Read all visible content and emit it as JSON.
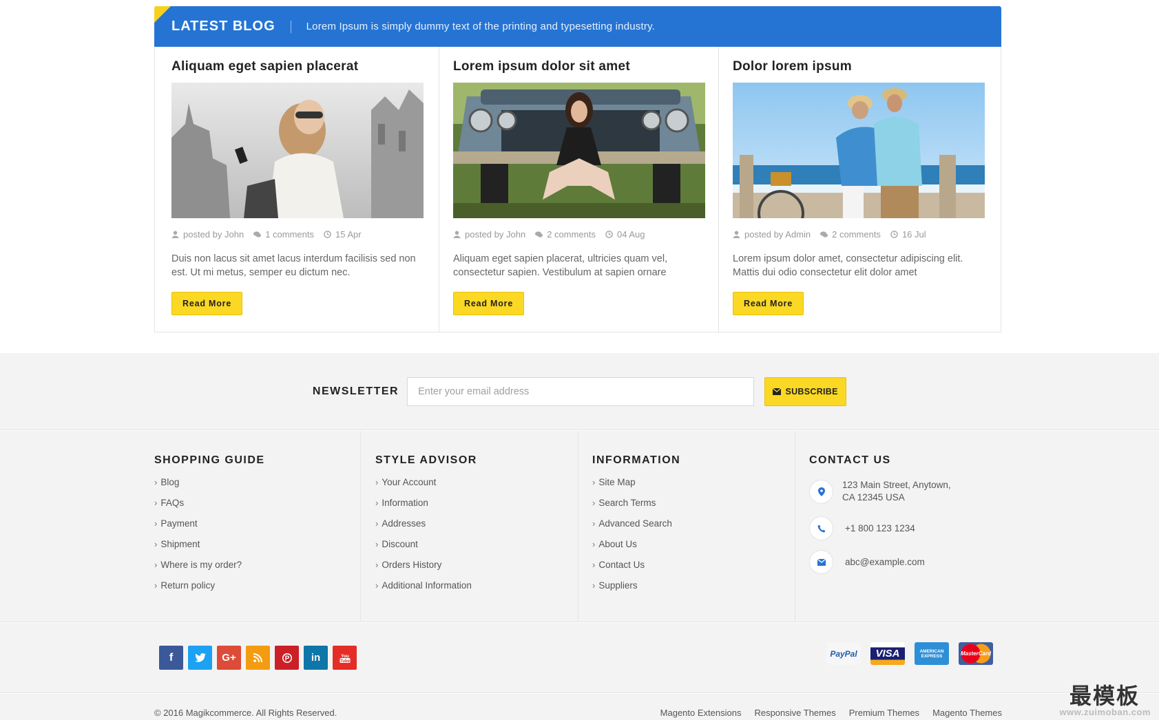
{
  "blog": {
    "title": "LATEST BLOG",
    "subtitle": "Lorem Ipsum is simply dummy text of the printing and typesetting industry.",
    "posts": [
      {
        "title": "Aliquam eget sapien placerat",
        "author": "posted by John",
        "comments": "1 comments",
        "date": "15 Apr",
        "excerpt": "Duis non lacus sit amet lacus interdum facilisis sed non est. Ut mi metus, semper eu dictum nec.",
        "button": "Read More"
      },
      {
        "title": "Lorem ipsum dolor sit amet",
        "author": "posted by John",
        "comments": "2 comments",
        "date": "04 Aug",
        "excerpt": "Aliquam eget sapien placerat, ultricies quam vel, consectetur sapien. Vestibulum at sapien ornare",
        "button": "Read More"
      },
      {
        "title": "Dolor lorem ipsum",
        "author": "posted by Admin",
        "comments": "2 comments",
        "date": "16 Jul",
        "excerpt": "Lorem ipsum dolor amet, consectetur adipiscing elit. Mattis dui odio consectetur elit dolor amet",
        "button": "Read More"
      }
    ]
  },
  "newsletter": {
    "label": "NEWSLETTER",
    "placeholder": "Enter your email address",
    "button": "SUBSCRIBE"
  },
  "footer": {
    "shopping_guide": {
      "title": "SHOPPING GUIDE",
      "items": [
        "Blog",
        "FAQs",
        "Payment",
        "Shipment",
        "Where is my order?",
        "Return policy"
      ]
    },
    "style_advisor": {
      "title": "STYLE ADVISOR",
      "items": [
        "Your Account",
        "Information",
        "Addresses",
        "Discount",
        "Orders History",
        "Additional Information"
      ]
    },
    "information": {
      "title": "INFORMATION",
      "items": [
        "Site Map",
        "Search Terms",
        "Advanced Search",
        "About Us",
        "Contact Us",
        "Suppliers"
      ]
    },
    "contact": {
      "title": "CONTACT US",
      "address_line1": "123 Main Street, Anytown,",
      "address_line2": "CA 12345 USA",
      "phone": "+1 800 123 1234",
      "email": "abc@example.com"
    }
  },
  "social": {
    "icons": [
      {
        "name": "facebook-icon",
        "glyph": "f",
        "color": "#3b5998"
      },
      {
        "name": "twitter-icon",
        "glyph": "t",
        "color": "#1da1f2"
      },
      {
        "name": "google-plus-icon",
        "glyph": "G+",
        "color": "#dd4b39"
      },
      {
        "name": "rss-icon",
        "glyph": "rss",
        "color": "#f39c12"
      },
      {
        "name": "pinterest-icon",
        "glyph": "P",
        "color": "#cb2027"
      },
      {
        "name": "linkedin-icon",
        "glyph": "in",
        "color": "#0e76a8"
      },
      {
        "name": "youtube-icon",
        "glyph": "You",
        "color": "#e52d27"
      }
    ]
  },
  "payments": {
    "paypal": "PayPal",
    "visa": "VISA",
    "amex": "AMERICAN EXPRESS",
    "mastercard": "MasterCard"
  },
  "bottom": {
    "copyright": "© 2016 Magikcommerce. All Rights Reserved.",
    "links": [
      "Magento Extensions",
      "Responsive Themes",
      "Premium Themes",
      "Magento Themes"
    ],
    "watermark": "最模板",
    "watermark_url": "www.zuimoban.com"
  },
  "colors": {
    "accent_blue": "#2574d4",
    "accent_yellow": "#fbd824",
    "footer_bg": "#f3f3f3"
  }
}
